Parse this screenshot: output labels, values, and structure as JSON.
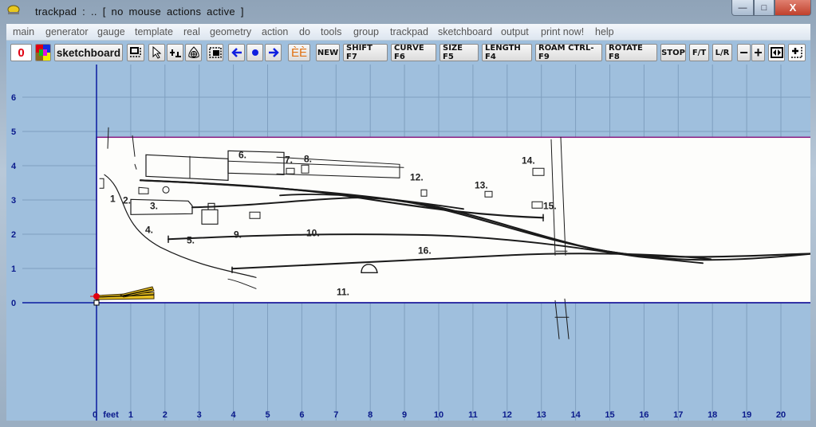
{
  "window": {
    "title": "trackpad :  ..   [ no  mouse  actions  active ]",
    "min_label": "—",
    "max_label": "□",
    "close_label": "X"
  },
  "menu": [
    {
      "label": "main"
    },
    {
      "label": "generator"
    },
    {
      "label": "gauge"
    },
    {
      "label": "template"
    },
    {
      "label": "real"
    },
    {
      "label": "geometry"
    },
    {
      "label": "action"
    },
    {
      "label": "do"
    },
    {
      "label": "tools"
    },
    {
      "label": "group"
    },
    {
      "label": "trackpad"
    },
    {
      "label": "sketchboard"
    },
    {
      "label": "output"
    },
    {
      "label": "print now!"
    },
    {
      "label": "help"
    }
  ],
  "toolbar": {
    "counter": "0",
    "sketchboard": "sketchboard",
    "ee_label": "ÈÈ",
    "buttons": [
      {
        "label": "NEW"
      },
      {
        "label": "SHIFT  F7"
      },
      {
        "label": "CURVE  F6"
      },
      {
        "label": "SIZE  F5"
      },
      {
        "label": "LENGTH  F4"
      },
      {
        "label": "ROAM  CTRL-F9"
      },
      {
        "label": "ROTATE  F8"
      },
      {
        "label": "STOP"
      },
      {
        "label": "F/T"
      },
      {
        "label": "L/R"
      }
    ],
    "zoom_out": "−",
    "zoom_in": "+"
  },
  "grid": {
    "units": "feet",
    "x_ticks": [
      "0",
      "1",
      "2",
      "3",
      "4",
      "5",
      "6",
      "7",
      "8",
      "9",
      "10",
      "11",
      "12",
      "13",
      "14",
      "15",
      "16",
      "17",
      "18",
      "19",
      "20"
    ],
    "y_ticks": [
      "0",
      "1",
      "2",
      "3",
      "4",
      "5",
      "6"
    ],
    "colors": {
      "background": "#9fbfdd",
      "grid": "#7f9fbf",
      "axis": "#0a1aa0",
      "label": "#0a1a8c",
      "image_border": "#8a1a80"
    }
  },
  "sketch": {
    "labels": [
      "1",
      "2.",
      "3.",
      "4.",
      "5.",
      "6.",
      "7.",
      "8.",
      "9.",
      "10.",
      "11.",
      "12.",
      "13.",
      "14.",
      "15.",
      "16."
    ]
  }
}
